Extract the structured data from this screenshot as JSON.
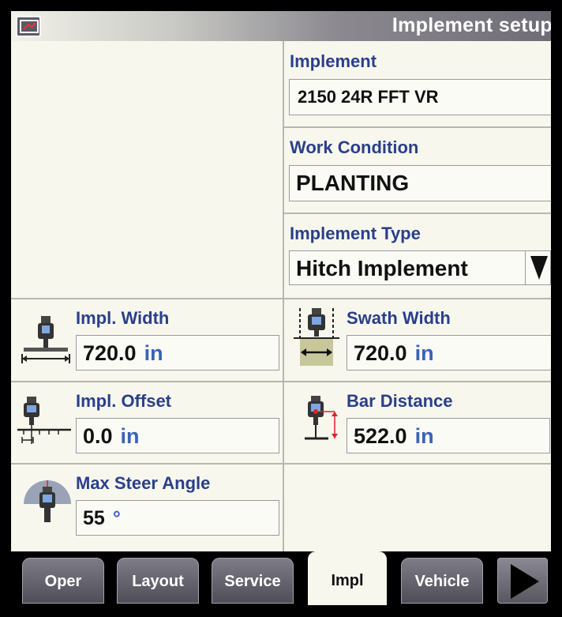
{
  "header": {
    "title": "Implement setup",
    "home_icon": "display-home-icon"
  },
  "implement": {
    "label": "Implement",
    "value": "2150 24R FFT VR"
  },
  "work_condition": {
    "label": "Work Condition",
    "value": "PLANTING"
  },
  "implement_type": {
    "label": "Implement Type",
    "value": "Hitch Implement"
  },
  "impl_width": {
    "label": "Impl. Width",
    "value": "720.0",
    "unit": "in"
  },
  "swath_width": {
    "label": "Swath Width",
    "value": "720.0",
    "unit": "in"
  },
  "impl_offset": {
    "label": "Impl. Offset",
    "value": "0.0",
    "unit": "in"
  },
  "bar_distance": {
    "label": "Bar Distance",
    "value": "522.0",
    "unit": "in"
  },
  "max_steer_angle": {
    "label": "Max Steer Angle",
    "value": "55",
    "unit": "°"
  },
  "tabs": [
    {
      "label": "Oper"
    },
    {
      "label": "Layout"
    },
    {
      "label": "Service"
    },
    {
      "label": "Impl"
    },
    {
      "label": "Vehicle"
    }
  ],
  "colors": {
    "label_blue": "#2a3f8a",
    "unit_blue": "#3a63b8",
    "panel_bg": "#f7f7ee",
    "swath_fill": "#c7c79a"
  }
}
